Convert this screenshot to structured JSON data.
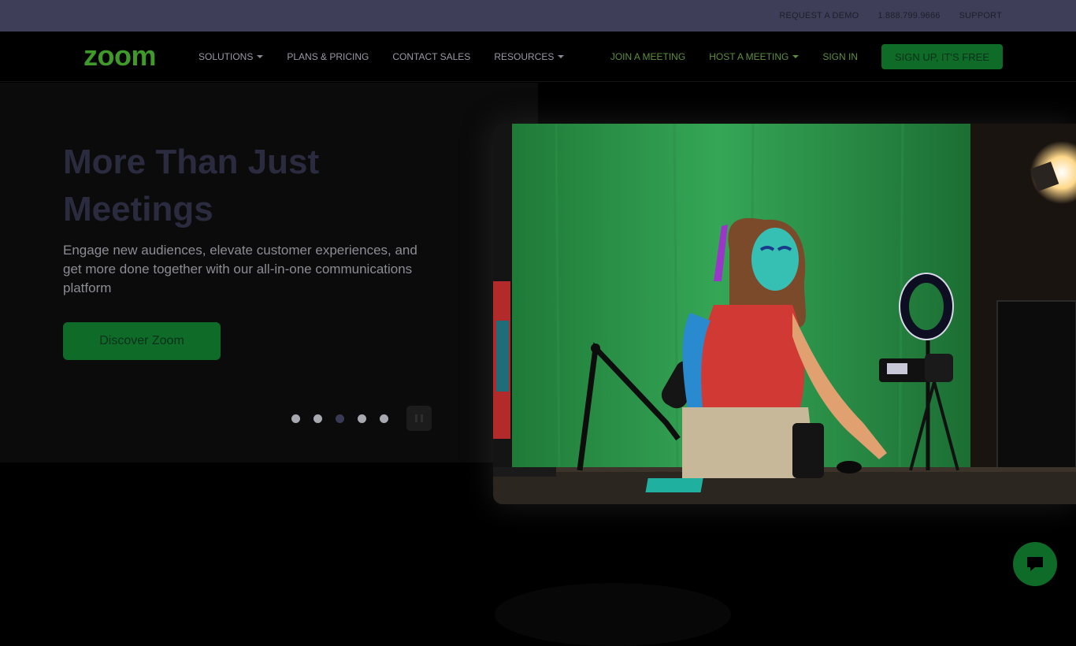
{
  "utility": {
    "links": [
      "REQUEST A DEMO",
      "1.888.799.9666",
      "SUPPORT"
    ]
  },
  "nav": {
    "logo_text": "zoom",
    "left": {
      "solutions": "SOLUTIONS",
      "plans": "PLANS & PRICING",
      "contact": "CONTACT SALES",
      "resources": "RESOURCES"
    },
    "right": {
      "join": "JOIN A MEETING",
      "host": "HOST A MEETING",
      "signin": "SIGN IN",
      "signup": "SIGN UP, IT'S FREE"
    }
  },
  "hero": {
    "title": "More Than Just Meetings",
    "subtitle": "Engage new audiences, elevate customer experiences, and get more done together with our all-in-one communications platform",
    "cta": "Discover Zoom",
    "slides_total": 5,
    "active_slide": 3
  },
  "icons": {
    "pause": "pause-icon",
    "chat": "chat-icon"
  },
  "colors": {
    "brand_green": "#0e6b28",
    "utility_bar": "#3e3e58",
    "background": "#000000"
  }
}
